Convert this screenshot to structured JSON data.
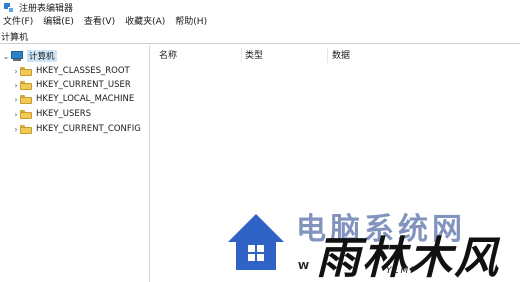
{
  "window": {
    "title": "注册表编辑器"
  },
  "menu": [
    {
      "label": "文件(F)"
    },
    {
      "label": "编辑(E)"
    },
    {
      "label": "查看(V)"
    },
    {
      "label": "收藏夹(A)"
    },
    {
      "label": "帮助(H)"
    }
  ],
  "address": {
    "path": "计算机"
  },
  "tree": {
    "root": {
      "label": "计算机",
      "expanded": true
    },
    "children": [
      {
        "label": "HKEY_CLASSES_ROOT"
      },
      {
        "label": "HKEY_CURRENT_USER"
      },
      {
        "label": "HKEY_LOCAL_MACHINE"
      },
      {
        "label": "HKEY_USERS"
      },
      {
        "label": "HKEY_CURRENT_CONFIG"
      }
    ]
  },
  "list": {
    "columns": [
      {
        "label": "名称"
      },
      {
        "label": "类型"
      },
      {
        "label": "数据"
      }
    ]
  },
  "watermark": {
    "cn_text": "电脑系统网",
    "brand": "雨林木风",
    "latin": "YLMF",
    "w_letter": "W",
    "house_color": "#2f63c6"
  }
}
